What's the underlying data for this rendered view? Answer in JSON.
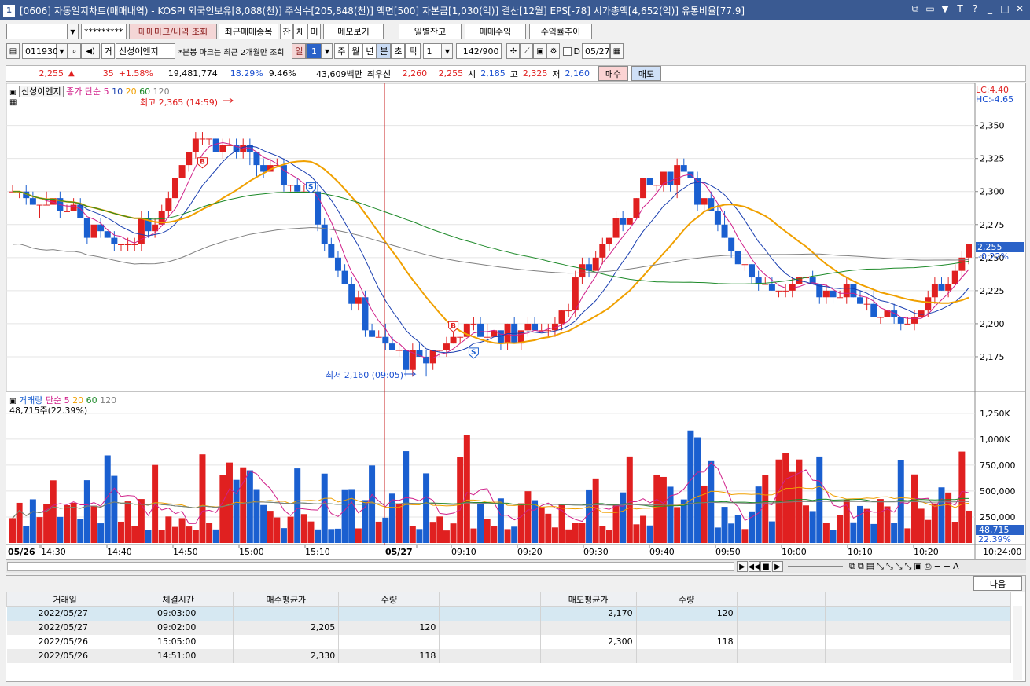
{
  "window": {
    "number": "1",
    "title": "[0606] 자동일지차트(매매내역) - KOSPI 외국인보유[8,088(천)] 주식수[205,848(천)] 액면[500] 자본금[1,030(억)] 결산[12월] EPS[-78] 시가총액[4,652(억)] 유통비율[77.9]"
  },
  "toolbar1": {
    "account_value": "",
    "password": "*********",
    "buttons": [
      "매매마크/내역 조회",
      "최근매매종목",
      "잔",
      "체",
      "미",
      "메모보기",
      "일별잔고",
      "매매수익",
      "수익률추이"
    ]
  },
  "toolbar2": {
    "code": "011930",
    "badge": "거",
    "name": "신성이엔지",
    "note": "*분봉 마크는 최근 2개월만 조회",
    "periods": [
      "일",
      "1",
      "주",
      "월",
      "년",
      "분",
      "초",
      "틱"
    ],
    "active_period": "분",
    "interval": "1",
    "count": "142/900",
    "date_label": "D",
    "date": "05/27"
  },
  "quote": {
    "price": "2,255",
    "change": "35",
    "change_pct": "+1.58%",
    "volume": "19,481,774",
    "rate1": "18.29%",
    "rate2": "9.46%",
    "amount": "43,609백만",
    "best_label": "최우선",
    "ask": "2,260",
    "bid": "2,255",
    "open_label": "시",
    "open": "2,185",
    "high_label": "고",
    "high": "2,325",
    "low_label": "저",
    "low": "2,160",
    "buy": "매수",
    "sell": "매도"
  },
  "price_panel": {
    "name": "신성이엔지",
    "ma_label": "종가 단순",
    "periods": [
      "5",
      "10",
      "20",
      "60",
      "120"
    ],
    "high_annot": "최고 2,365 (14:59)",
    "low_annot": "최저 2,160 (09:05)",
    "lc": "LC:4.40",
    "hc": "HC:-4.65",
    "current": "2,255",
    "current_pct": "-0.22%",
    "yticks": [
      "2,350",
      "2,325",
      "2,300",
      "2,275",
      "2,250",
      "2,225",
      "2,200",
      "2,175"
    ]
  },
  "volume_panel": {
    "label": "거래량",
    "ma_label": "단순",
    "periods": [
      "5",
      "20",
      "60",
      "120"
    ],
    "info": "48,715주(22.39%)",
    "current": "48,715",
    "current_pct": "22.39%",
    "yticks": [
      "1,250K",
      "1,000K",
      "750,000",
      "500,000",
      "250,000"
    ]
  },
  "xaxis": {
    "ticks": [
      "05/26",
      "14:30",
      "14:40",
      "14:50",
      "15:00",
      "15:10",
      "05/27",
      "09:10",
      "09:20",
      "09:30",
      "09:40",
      "09:50",
      "10:00",
      "10:10",
      "10:20"
    ],
    "right": "10:24:00"
  },
  "table": {
    "next": "다음",
    "headers": [
      "거래일",
      "체결시간",
      "매수평균가",
      "수량",
      "",
      "매도평균가",
      "수량",
      "",
      "",
      ""
    ],
    "rows": [
      [
        "2022/05/27",
        "09:03:00",
        "",
        "",
        "",
        "2,170",
        "120",
        "",
        "",
        ""
      ],
      [
        "2022/05/27",
        "09:02:00",
        "2,205",
        "120",
        "",
        "",
        "",
        "",
        "",
        ""
      ],
      [
        "2022/05/26",
        "15:05:00",
        "",
        "",
        "",
        "2,300",
        "118",
        "",
        "",
        ""
      ],
      [
        "2022/05/26",
        "14:51:00",
        "2,330",
        "118",
        "",
        "",
        "",
        "",
        "",
        ""
      ]
    ]
  },
  "colors": {
    "up": "#e02020",
    "down": "#1a5fd0",
    "ma5": "#d0208a",
    "ma10": "#1a3fb0",
    "ma20": "#f0a000",
    "ma60": "#1e8a2a",
    "ma120": "#808080"
  },
  "chart_data": {
    "type": "candlestick",
    "seed": 7,
    "n": 142,
    "ylim": [
      2150,
      2370
    ],
    "vol_ylim": [
      0,
      1400000
    ]
  }
}
